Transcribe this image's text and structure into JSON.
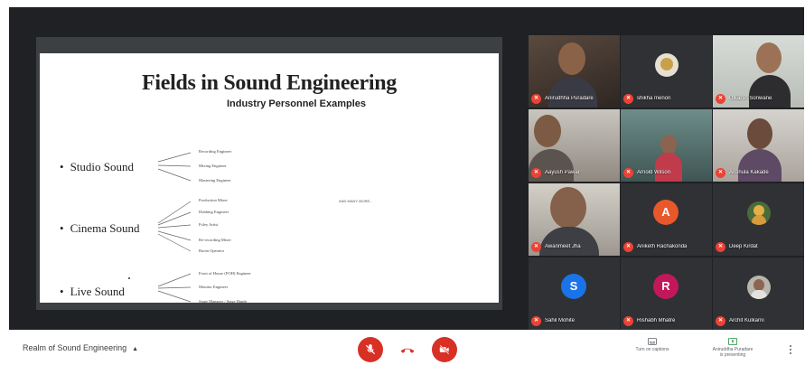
{
  "slide": {
    "title": "Fields in Sound Engineering",
    "subtitle": "Industry Personnel Examples",
    "fields": [
      {
        "label": "Studio Sound",
        "roles": [
          "Recording Engineer",
          "Mixing Engineer",
          "Mastering Engineer"
        ]
      },
      {
        "label": "Cinema Sound",
        "roles": [
          "Production Mixer",
          "Dubbing Engineer",
          "Foley Artist",
          "Re-recording Mixer",
          "Boom Operator"
        ]
      },
      {
        "label": "Live Sound",
        "roles": [
          "Front of House (FOH) Engineer",
          "Monitor Engineer",
          "Stage Manager / Stage Hands"
        ]
      }
    ],
    "see_more": "AND MANY MORE..."
  },
  "participants": [
    {
      "name": "Anirudhha Puradare",
      "type": "video"
    },
    {
      "name": "shikha menon",
      "type": "avatar"
    },
    {
      "name": "Utkarsh Sonwane",
      "type": "video"
    },
    {
      "name": "Aayush Pawar",
      "type": "video"
    },
    {
      "name": "Arnold Wilson",
      "type": "video"
    },
    {
      "name": "Anshula Kakade",
      "type": "video"
    },
    {
      "name": "Awanmeet Jha",
      "type": "video"
    },
    {
      "name": "Aniketh Rachakonda",
      "type": "initial",
      "initial": "A",
      "color": "#e8582a"
    },
    {
      "name": "Deep Kirdat",
      "type": "avatar"
    },
    {
      "name": "Sahil Mohite",
      "type": "initial",
      "initial": "S",
      "color": "#1a73e8"
    },
    {
      "name": "Rishabh Mhatre",
      "type": "initial",
      "initial": "R",
      "color": "#c2185b"
    },
    {
      "name": "Archit Kulkarni",
      "type": "avatar"
    }
  ],
  "bottom_bar": {
    "meeting_name": "Realm of Sound Engineering",
    "captions_label": "Turn on captions",
    "presenting_label_1": "Aniruddha Puradare",
    "presenting_label_2": "is presenting"
  },
  "colors": {
    "stage": "#202124",
    "end_call": "#d93025",
    "mute_badge": "#ea4335"
  },
  "icons": {
    "mic": "mic-off-icon",
    "hangup": "hangup-icon",
    "camera": "camera-off-icon",
    "captions": "captions-icon",
    "presenting": "present-icon",
    "more": "more-vert-icon"
  }
}
